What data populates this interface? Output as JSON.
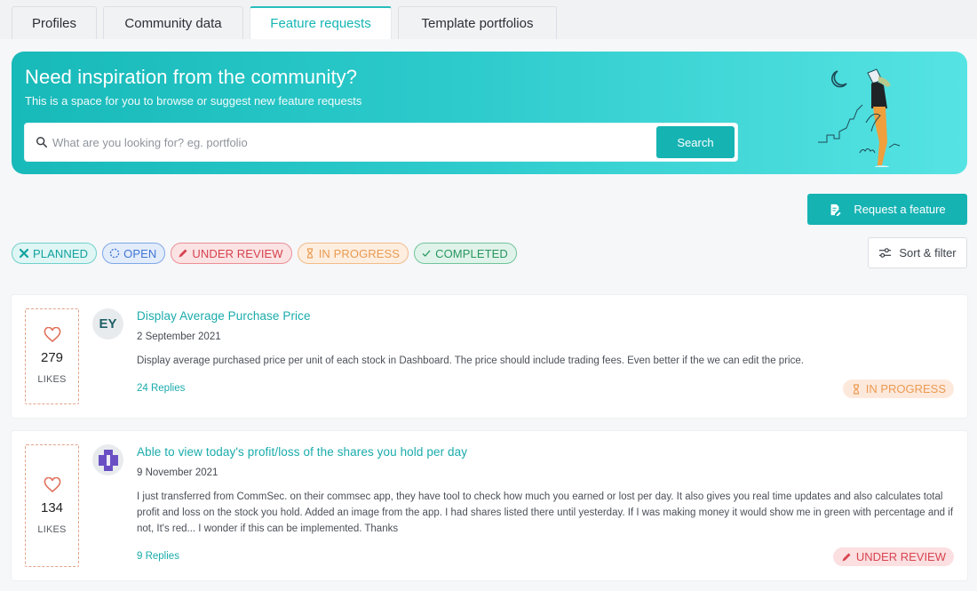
{
  "tabs": [
    {
      "label": "Profiles",
      "active": false
    },
    {
      "label": "Community data",
      "active": false
    },
    {
      "label": "Feature requests",
      "active": true
    },
    {
      "label": "Template portfolios",
      "active": false
    }
  ],
  "hero": {
    "title": "Need inspiration from the community?",
    "subtitle": "This is a space for you to browse or suggest new feature requests",
    "search_placeholder": "What are you looking for? eg. portfolio",
    "search_value": "",
    "search_button": "Search",
    "illustration": "person-with-telescope-and-moon-illustration"
  },
  "actions": {
    "request_button": "Request a feature",
    "request_icon": "document-edit-icon",
    "sort_button": "Sort & filter",
    "sort_icon": "sliders-icon"
  },
  "status_filters": [
    {
      "label": "PLANNED",
      "icon": "tools-icon",
      "color": "#12a29d"
    },
    {
      "label": "OPEN",
      "icon": "dashed-circle-icon",
      "color": "#3e76d4"
    },
    {
      "label": "UNDER REVIEW",
      "icon": "pencil-icon",
      "color": "#d6424e"
    },
    {
      "label": "IN PROGRESS",
      "icon": "hourglass-icon",
      "color": "#ea9a4f"
    },
    {
      "label": "COMPLETED",
      "icon": "check-icon",
      "color": "#27965f"
    }
  ],
  "requests": [
    {
      "likes": "279",
      "likes_label": "LIKES",
      "avatar_initials": "EY",
      "title": "Display Average Purchase Price",
      "date": "2 September 2021",
      "body": "Display average purchased price per unit of each stock in Dashboard. The price should include trading fees. Even better if the we can edit the price.",
      "replies": "24 Replies",
      "status": "IN PROGRESS"
    },
    {
      "likes": "134",
      "likes_label": "LIKES",
      "avatar_initials": "",
      "title": "Able to view today's profit/loss of the shares you hold per day",
      "date": "9 November 2021",
      "body": "I just transferred from CommSec. on their commsec app, they have tool to check how much you earned or lost per day. It also gives you real time updates and also calculates total profit and loss on the stock you hold. Added an image from the app. I had shares listed there until yesterday. If I was making money it would show me in green with percentage and if not, It's red... I wonder if this can be implemented. Thanks",
      "replies": "9 Replies",
      "status": "UNDER REVIEW"
    }
  ],
  "colors": {
    "accent": "#16b3b3",
    "page_background": "#f6f7f9"
  }
}
